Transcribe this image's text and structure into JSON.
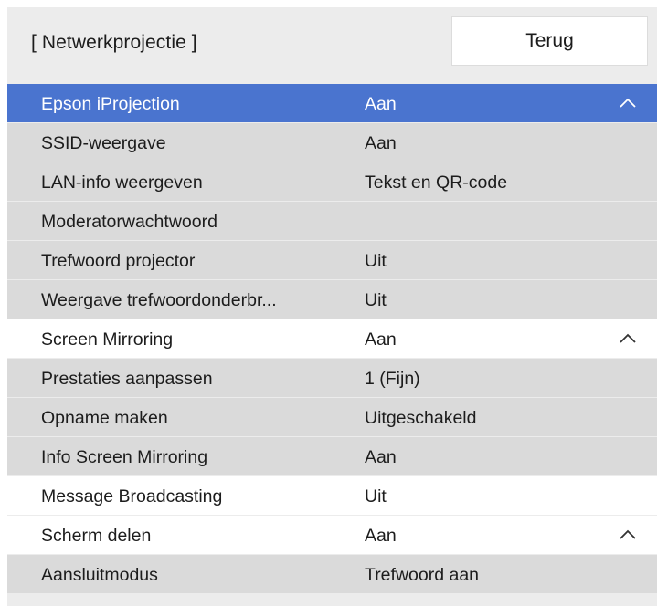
{
  "header": {
    "title": "[ Netwerkprojectie ]",
    "back_label": "Terug"
  },
  "colors": {
    "selected_row": "#4a74cf",
    "sub_row": "#dadada",
    "main_row": "#ffffff",
    "panel_background": "#ececec"
  },
  "menu": {
    "rows": [
      {
        "label": "Epson iProjection",
        "value": "Aan",
        "kind": "main",
        "selected": true,
        "expanded": true,
        "icon": "chevron-up-icon"
      },
      {
        "label": "SSID-weergave",
        "value": "Aan",
        "kind": "sub"
      },
      {
        "label": "LAN-info weergeven",
        "value": "Tekst en QR-code",
        "kind": "sub"
      },
      {
        "label": "Moderatorwachtwoord",
        "value": "",
        "kind": "sub"
      },
      {
        "label": "Trefwoord projector",
        "value": "Uit",
        "kind": "sub"
      },
      {
        "label": "Weergave trefwoordonderbr...",
        "value": "Uit",
        "kind": "sub"
      },
      {
        "label": "Screen Mirroring",
        "value": "Aan",
        "kind": "main",
        "expanded": true,
        "icon": "chevron-up-icon"
      },
      {
        "label": "Prestaties aanpassen",
        "value": "1 (Fijn)",
        "kind": "sub"
      },
      {
        "label": "Opname maken",
        "value": "Uitgeschakeld",
        "kind": "sub"
      },
      {
        "label": "Info Screen Mirroring",
        "value": "Aan",
        "kind": "sub"
      },
      {
        "label": "Message Broadcasting",
        "value": "Uit",
        "kind": "main"
      },
      {
        "label": "Scherm delen",
        "value": "Aan",
        "kind": "main",
        "expanded": true,
        "icon": "chevron-up-icon"
      },
      {
        "label": "Aansluitmodus",
        "value": "Trefwoord aan",
        "kind": "sub"
      }
    ]
  }
}
